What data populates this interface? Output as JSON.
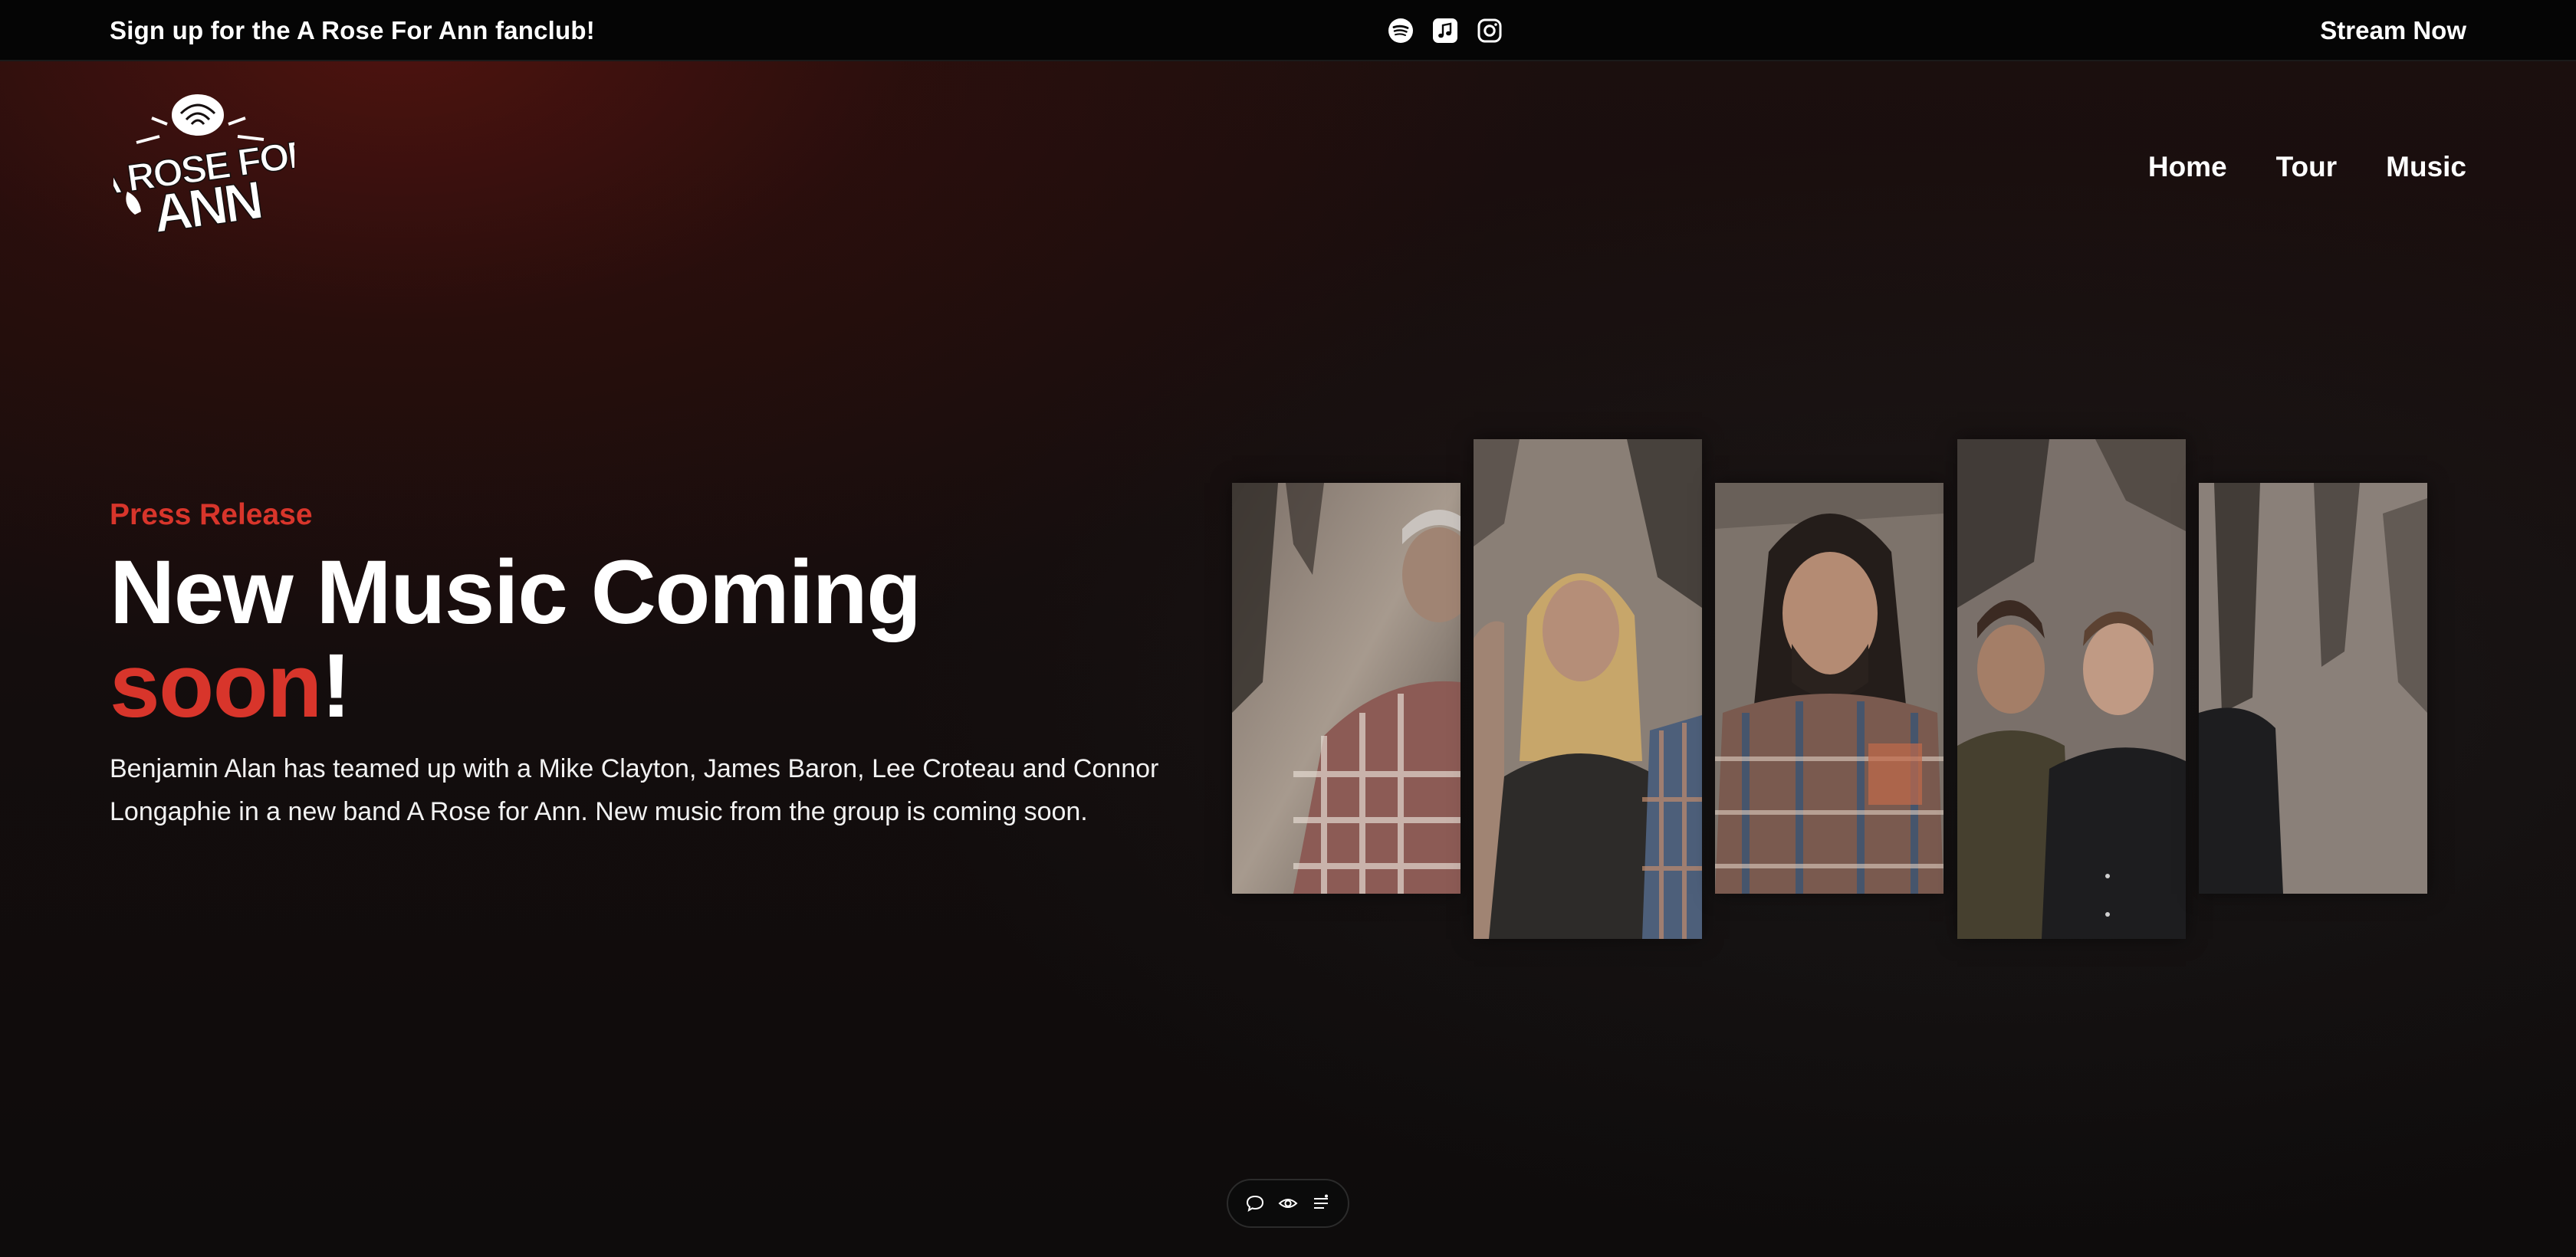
{
  "topbar": {
    "signup_text": "Sign up for the A Rose For Ann fanclub!",
    "icons": [
      "spotify-icon",
      "apple-music-icon",
      "instagram-icon"
    ],
    "stream_label": "Stream Now"
  },
  "header": {
    "logo_text_line1": "A ROSE FOR",
    "logo_text_line2": "ANN",
    "nav": [
      {
        "label": "Home"
      },
      {
        "label": "Tour"
      },
      {
        "label": "Music"
      }
    ]
  },
  "hero": {
    "eyebrow": "Press Release",
    "headline_main": "New Music Coming",
    "headline_accent": "soon",
    "headline_end": "!",
    "body": "Benjamin Alan has teamed up with a Mike Clayton, James Baron, Lee Croteau and Connor Longaphie in a new band A Rose for Ann. New music from the group is coming soon."
  },
  "toolbar": {
    "icons": [
      "comment-icon",
      "eye-icon",
      "list-icon"
    ]
  },
  "colors": {
    "accent": "#d8352b",
    "topbar_bg": "#050505",
    "text": "#ffffff"
  }
}
